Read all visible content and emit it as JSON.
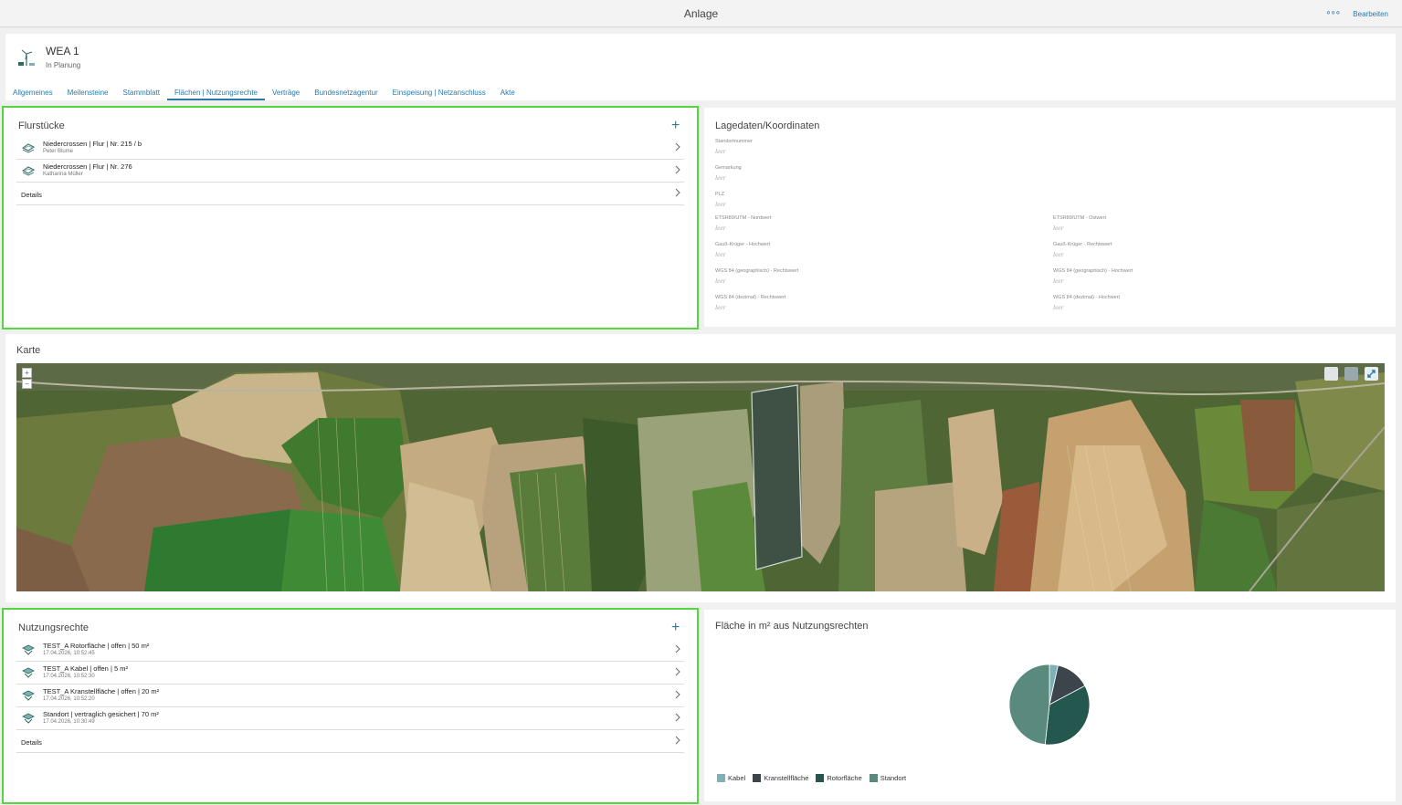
{
  "topbar": {
    "title": "Anlage",
    "more": "∘∘∘",
    "edit": "Bearbeiten"
  },
  "header": {
    "name": "WEA 1",
    "status": "In Planung",
    "tabs": [
      {
        "label": "Allgemeines"
      },
      {
        "label": "Meilensteine"
      },
      {
        "label": "Stammblatt"
      },
      {
        "label": "Flächen | Nutzungsrechte",
        "active": true
      },
      {
        "label": "Verträge"
      },
      {
        "label": "Bundesnetzagentur"
      },
      {
        "label": "Einspeisung | Netzanschluss"
      },
      {
        "label": "Akte"
      }
    ]
  },
  "flurstuecke": {
    "title": "Flurstücke",
    "add": "+",
    "items": [
      {
        "title": "Niedercrossen | Flur | Nr. 215 / b",
        "sub": "Peter Blume"
      },
      {
        "title": "Niedercrossen | Flur | Nr. 276",
        "sub": "Katharina Müller"
      }
    ],
    "details": "Details"
  },
  "lagedaten": {
    "title": "Lagedaten/Koordinaten",
    "left": [
      {
        "label": "Standortnummer",
        "value": "leer"
      },
      {
        "label": "Gemarkung",
        "value": "leer"
      },
      {
        "label": "PLZ",
        "value": "leer"
      },
      {
        "label": "ETSR89/UTM - Nordwert",
        "value": "leer"
      },
      {
        "label": "Gauß-Krüger - Hochwert",
        "value": "leer"
      },
      {
        "label": "WGS 84 (geographisch) - Rechtswert",
        "value": "leer"
      },
      {
        "label": "WGS 84 (dezimal) - Rechtswert",
        "value": "leer"
      }
    ],
    "right": [
      {
        "label": "ETSR89/UTM - Ostwert",
        "value": "leer"
      },
      {
        "label": "Gauß-Krüger - Rechtswert",
        "value": "leer"
      },
      {
        "label": "WGS 84 (geographisch) - Hochwert",
        "value": "leer"
      },
      {
        "label": "WGS 84 (dezimal) - Hochwert",
        "value": "leer"
      }
    ]
  },
  "karte": {
    "title": "Karte",
    "zoom_in": "+",
    "zoom_out": "−"
  },
  "nutzungsrechte": {
    "title": "Nutzungsrechte",
    "add": "+",
    "items": [
      {
        "title": "TEST_A Rotorfläche | offen | 50 m²",
        "sub": "17.04.2026, 10:52:45"
      },
      {
        "title": "TEST_A Kabel | offen | 5 m²",
        "sub": "17.04.2026, 10:52:30"
      },
      {
        "title": "TEST_A Kranstellfläche | offen | 20 m²",
        "sub": "17.04.2026, 10:52:20"
      },
      {
        "title": "Standort | vertraglich gesichert | 70 m²",
        "sub": "17.04.2026, 10:30:49"
      }
    ],
    "details": "Details"
  },
  "chart_title": "Fläche in m² aus Nutzungsrechten",
  "chart_data": {
    "type": "pie",
    "title": "Fläche in m² aus Nutzungsrechten",
    "categories": [
      "Kabel",
      "Kranstellfläche",
      "Rotorfläche",
      "Standort"
    ],
    "values": [
      5,
      20,
      50,
      70
    ],
    "colors": [
      "#7fb0b6",
      "#3c454c",
      "#24584f",
      "#5a8a7e"
    ],
    "legend": "bottom-left"
  }
}
